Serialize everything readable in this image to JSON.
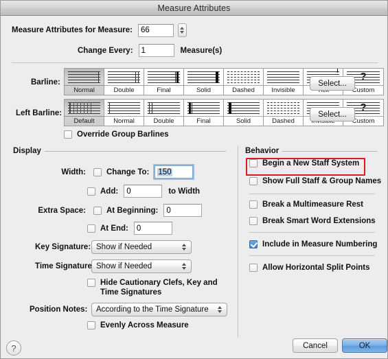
{
  "window": {
    "title": "Measure Attributes"
  },
  "top": {
    "measure_label": "Measure Attributes for Measure:",
    "measure_value": "66",
    "change_every_label": "Change Every:",
    "change_every_value": "1",
    "change_every_unit": "Measure(s)"
  },
  "barline": {
    "label": "Barline:",
    "select_label": "Select...",
    "selected_index": 0,
    "options": [
      "Normal",
      "Double",
      "Final",
      "Solid",
      "Dashed",
      "Invisible",
      "Tick",
      "Custom"
    ]
  },
  "left_barline": {
    "label": "Left Barline:",
    "select_label": "Select...",
    "selected_index": 0,
    "options": [
      "Default",
      "Normal",
      "Double",
      "Final",
      "Solid",
      "Dashed",
      "Invisible",
      "Custom"
    ]
  },
  "override_group_barlines": {
    "label": "Override Group Barlines",
    "checked": false
  },
  "display": {
    "group_label": "Display",
    "width_label": "Width:",
    "change_to_label": "Change To:",
    "change_to_value": "150",
    "change_to_checked": false,
    "add_label": "Add:",
    "add_value": "0",
    "add_checked": false,
    "to_width_label": "to Width",
    "extra_space_label": "Extra Space:",
    "at_beginning_label": "At Beginning:",
    "at_beginning_value": "0",
    "at_beginning_checked": false,
    "at_end_label": "At End:",
    "at_end_value": "0",
    "at_end_checked": false,
    "key_signature_label": "Key Signature:",
    "key_signature_value": "Show if Needed",
    "time_signature_label": "Time Signature:",
    "time_signature_value": "Show if Needed",
    "hide_cautionary_line1": "Hide Cautionary Clefs, Key and",
    "hide_cautionary_line2": "Time Signatures",
    "hide_cautionary_checked": false,
    "position_notes_label": "Position Notes:",
    "position_notes_value": "According to the Time Signature",
    "evenly_label": "Evenly Across Measure",
    "evenly_checked": false
  },
  "behavior": {
    "group_label": "Behavior",
    "items": [
      {
        "label": "Begin a New Staff System",
        "checked": false,
        "highlighted": true
      },
      {
        "label": "Show Full Staff & Group Names",
        "checked": false,
        "highlighted": false
      },
      {
        "label": "Break a Multimeasure Rest",
        "checked": false,
        "highlighted": false
      },
      {
        "label": "Break Smart Word Extensions",
        "checked": false,
        "highlighted": false
      },
      {
        "label": "Include in Measure Numbering",
        "checked": true,
        "highlighted": false
      },
      {
        "label": "Allow Horizontal Split Points",
        "checked": false,
        "highlighted": false
      }
    ]
  },
  "footer": {
    "help_label": "?",
    "cancel_label": "Cancel",
    "ok_label": "OK"
  },
  "colors": {
    "accent_blue": "#3e84cc",
    "annotation_red": "#e01b1b",
    "window_bg": "#ededed"
  }
}
